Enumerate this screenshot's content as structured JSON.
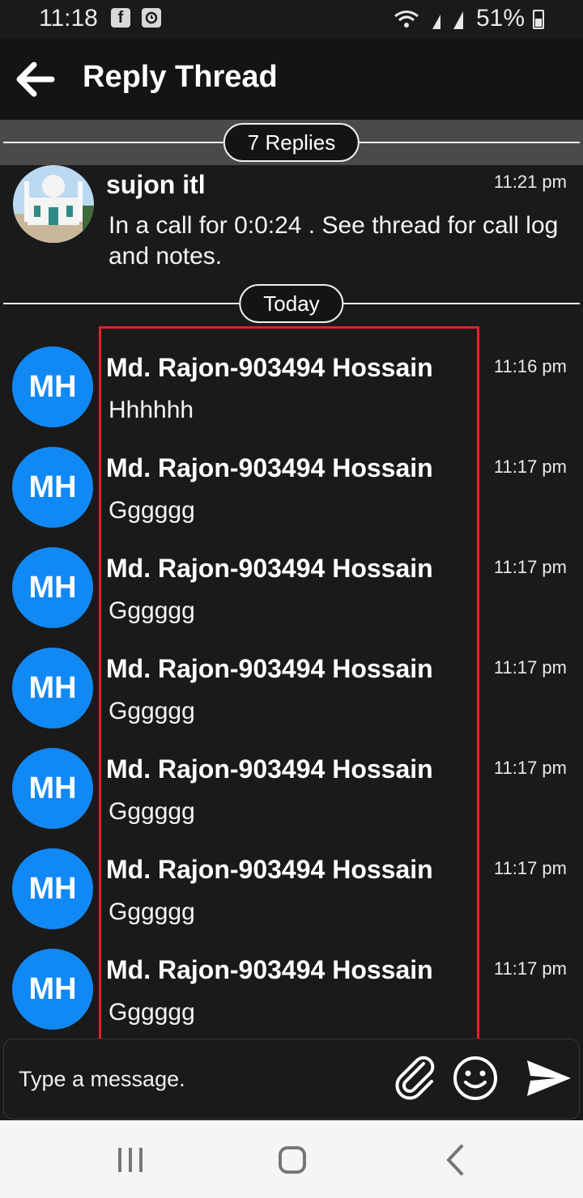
{
  "status_bar": {
    "time": "11:18",
    "fb_icon": "facebook-icon",
    "clock_icon": "alarm-icon",
    "battery": "51%"
  },
  "app_bar": {
    "title": "Reply Thread",
    "back_icon": "arrow-left-icon"
  },
  "replies_divider": {
    "label": "7 Replies"
  },
  "parent_message": {
    "sender": "sujon itl",
    "time": "11:21 pm",
    "text": "In a call for 0:0:24 . See thread for call log and notes."
  },
  "date_divider": {
    "label": "Today"
  },
  "avatar_color": "#1189f5",
  "highlight_color": "#e5202a",
  "messages": [
    {
      "initials": "MH",
      "sender": "Md. Rajon-903494 Hossain",
      "time": "11:16 pm",
      "text": "Hhhhhh"
    },
    {
      "initials": "MH",
      "sender": "Md. Rajon-903494 Hossain",
      "time": "11:17 pm",
      "text": "Gggggg"
    },
    {
      "initials": "MH",
      "sender": "Md. Rajon-903494 Hossain",
      "time": "11:17 pm",
      "text": "Gggggg"
    },
    {
      "initials": "MH",
      "sender": "Md. Rajon-903494 Hossain",
      "time": "11:17 pm",
      "text": "Gggggg"
    },
    {
      "initials": "MH",
      "sender": "Md. Rajon-903494 Hossain",
      "time": "11:17 pm",
      "text": "Gggggg"
    },
    {
      "initials": "MH",
      "sender": "Md. Rajon-903494 Hossain",
      "time": "11:17 pm",
      "text": "Gggggg"
    },
    {
      "initials": "MH",
      "sender": "Md. Rajon-903494 Hossain",
      "time": "11:17 pm",
      "text": "Gggggg"
    }
  ],
  "composer": {
    "placeholder": "Type a message.",
    "attach_icon": "paperclip-icon",
    "emoji_icon": "smiley-icon",
    "send_icon": "send-icon"
  },
  "nav_bar": {
    "recents_icon": "recents-icon",
    "home_icon": "home-icon",
    "back_icon": "back-chevron-icon"
  }
}
